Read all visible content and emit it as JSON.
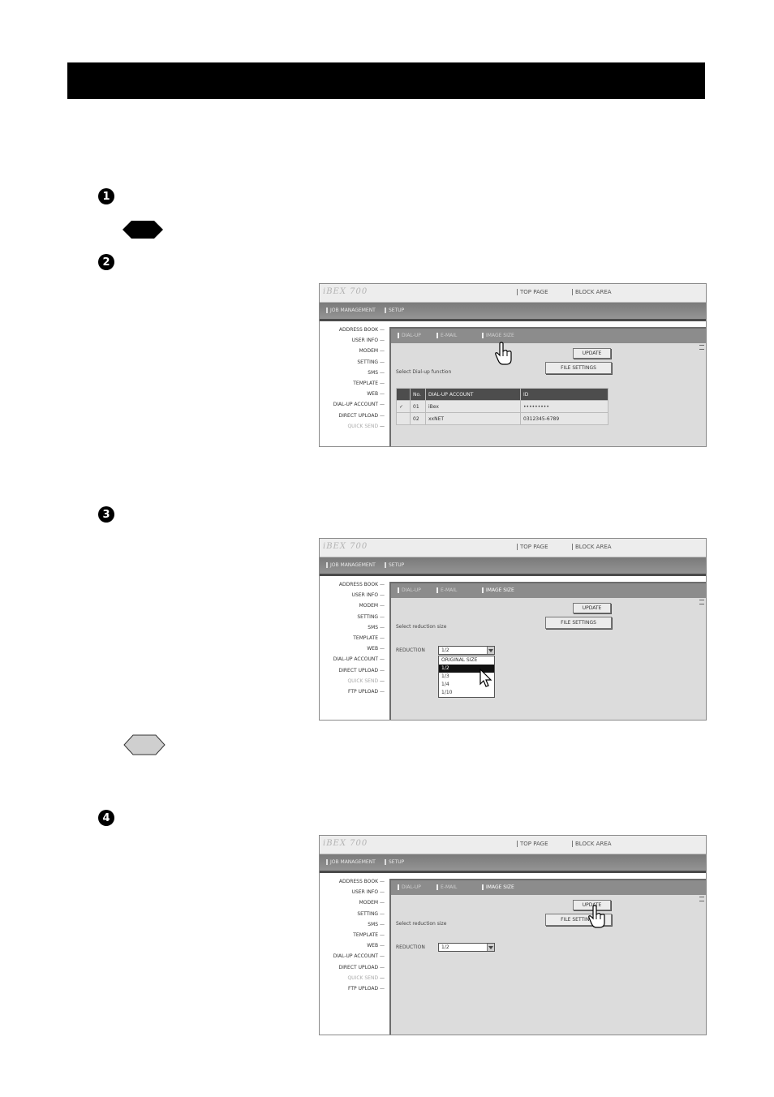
{
  "page": {
    "step_numbers": [
      "1",
      "2",
      "3",
      "4"
    ]
  },
  "ui": {
    "logo": "iBEX 700",
    "top_links": [
      "TOP PAGE",
      "BLOCK AREA"
    ],
    "nav_tabs": [
      "JOB MANAGEMENT",
      "SETUP"
    ],
    "sidebar": [
      "ADDRESS BOOK",
      "USER INFO",
      "MODEM",
      "SETTING",
      "SMS",
      "TEMPLATE",
      "WEB",
      "DIAL-UP ACCOUNT",
      "DIRECT UPLOAD",
      "QUICK SEND",
      "FTP UPLOAD"
    ],
    "panel_tabs": [
      "DIAL-UP",
      "E-MAIL",
      "IMAGE SIZE"
    ],
    "update_label": "UPDATE",
    "file_settings_label": "FILE SETTINGS"
  },
  "screenshot1": {
    "desc_text": "Select Dial-up function",
    "table_headers": [
      "",
      "No.",
      "DIAL-UP ACCOUNT",
      "ID"
    ],
    "table_rows": [
      [
        "✓",
        "01",
        "iBex",
        "•••••••••"
      ],
      [
        "",
        "02",
        "xxNET",
        "0312345-6789"
      ]
    ]
  },
  "screenshot2": {
    "desc_text": "Select reduction size",
    "reduction_label": "REDUCTION",
    "select_value": "1/2",
    "options": [
      "ORIGINAL SIZE",
      "1/2",
      "1/3",
      "1/4",
      "1/10"
    ]
  },
  "screenshot3": {
    "desc_text": "Select reduction size",
    "reduction_label": "REDUCTION",
    "select_value": "1/2"
  }
}
